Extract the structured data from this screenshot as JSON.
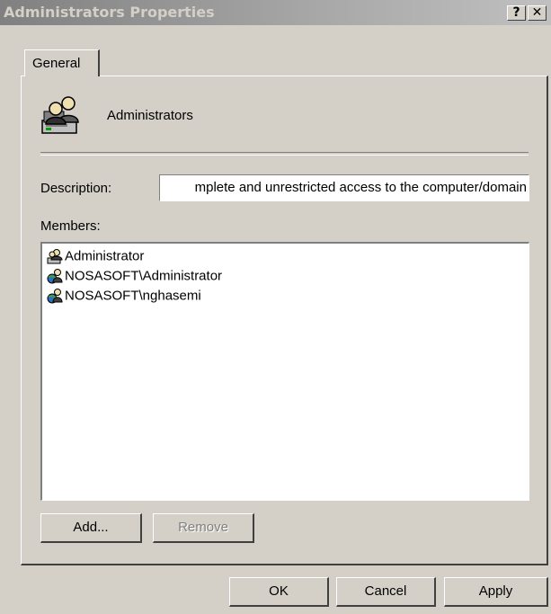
{
  "window": {
    "title": "Administrators Properties",
    "help_glyph": "?",
    "close_glyph": "✕"
  },
  "tabs": [
    {
      "label": "General",
      "selected": true
    }
  ],
  "group": {
    "name": "Administrators",
    "icon": "group-users-icon"
  },
  "description": {
    "label": "Description:",
    "value": "mplete and unrestricted access to the computer/domain"
  },
  "members": {
    "label": "Members:",
    "items": [
      {
        "name": "Administrator",
        "icon": "local-user-icon"
      },
      {
        "name": "NOSASOFT\\Administrator",
        "icon": "domain-user-icon"
      },
      {
        "name": "NOSASOFT\\nghasemi",
        "icon": "domain-user-icon"
      }
    ]
  },
  "buttons": {
    "add": "Add...",
    "remove": "Remove",
    "ok": "OK",
    "cancel": "Cancel",
    "apply": "Apply"
  },
  "colors": {
    "face": "#d4d0c8",
    "titlebar_inactive": "#808080",
    "disabled_text": "#808080"
  }
}
